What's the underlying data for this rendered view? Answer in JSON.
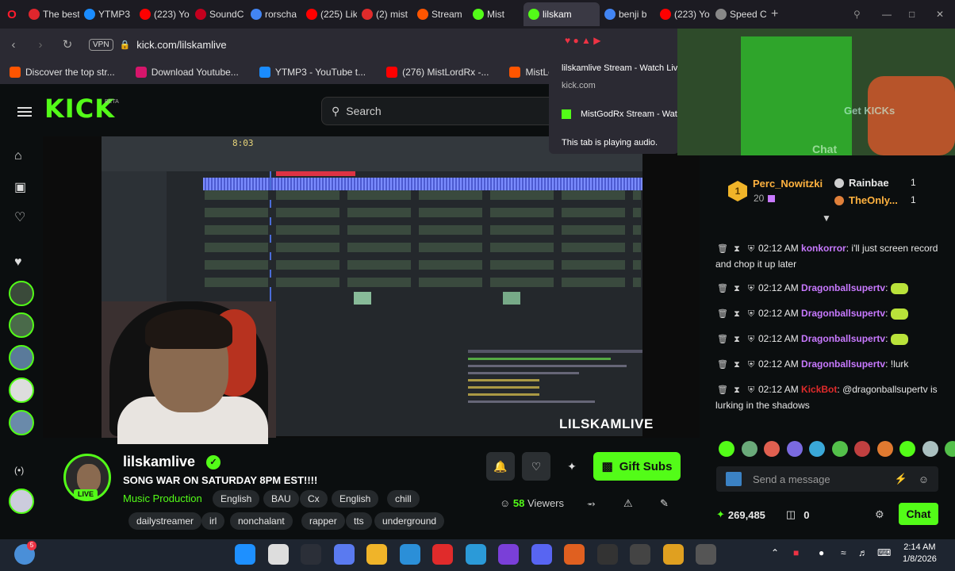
{
  "browser": {
    "tabs": [
      {
        "label": "The best",
        "color": "#e0262d"
      },
      {
        "label": "YTMP3",
        "color": "#1a8cff"
      },
      {
        "label": "(223) Yo",
        "color": "#ff0000"
      },
      {
        "label": "SoundC",
        "color": "#c3001e"
      },
      {
        "label": "rorscha",
        "color": "#4285f4"
      },
      {
        "label": "(225) Lik",
        "color": "#ff0000"
      },
      {
        "label": "(2) mist",
        "color": "#e02b2b"
      },
      {
        "label": "Stream",
        "color": "#ff5500"
      },
      {
        "label": "Mist",
        "color": "#53fc18"
      },
      {
        "label": "lilskam",
        "color": "#53fc18"
      },
      {
        "label": "benji b",
        "color": "#4285f4"
      },
      {
        "label": "(223) Yo",
        "color": "#ff0000"
      },
      {
        "label": "Speed C",
        "color": "#888888"
      }
    ],
    "url": "kick.com/lilskamlive",
    "vpn_label": "VPN",
    "bookmarks": [
      {
        "label": "Discover the top str...",
        "color": "#ff5500"
      },
      {
        "label": "Download Youtube...",
        "color": "#d6156b"
      },
      {
        "label": "YTMP3 - YouTube t...",
        "color": "#1a8cff"
      },
      {
        "label": "(276) MistLordRx -...",
        "color": "#ff0000"
      },
      {
        "label": "MistLordRx idek...",
        "color": "#ff5500"
      }
    ]
  },
  "tab_popup": {
    "title": "lilskamlive Stream - Watch Live on Kick",
    "domain": "kick.com",
    "other_tab": "MistGodRx Stream - Watch Live on Kick",
    "audio_note": "This tab is playing audio."
  },
  "kick": {
    "logo": "KICK",
    "beta": "BETA",
    "search_placeholder": "Search"
  },
  "video": {
    "watermark": "LILSKAMLIVE",
    "daw_time": "8:03"
  },
  "channel": {
    "name": "lilskamlive",
    "live_badge": "LIVE",
    "stream_title": "SONG WAR ON SATURDAY 8PM EST!!!!",
    "category": "Music Production",
    "tags_row1": [
      "English",
      "BAU",
      "Cx",
      "English",
      "chill"
    ],
    "tags_row2": [
      "dailystreamer",
      "irl",
      "nonchalant",
      "rapper",
      "tts",
      "underground"
    ],
    "gift_label": "Gift Subs",
    "viewers_count": "58",
    "viewers_label": "Viewers"
  },
  "leaderboard": {
    "first_name": "Perc_Nowitzki",
    "first_count": "20",
    "second_name": "Rainbae",
    "second_count": "1",
    "third_name": "TheOnly...",
    "third_count": "1"
  },
  "chat": {
    "messages": [
      {
        "time": "02:12 AM",
        "user": "konkorror",
        "color": "#c879ff",
        "text": "i'll just screen record and chop it up later"
      },
      {
        "time": "02:12 AM",
        "user": "Dragonballsupertv",
        "color": "#c879ff",
        "text": ""
      },
      {
        "time": "02:12 AM",
        "user": "Dragonballsupertv",
        "color": "#c879ff",
        "text": ""
      },
      {
        "time": "02:12 AM",
        "user": "Dragonballsupertv",
        "color": "#c879ff",
        "text": ""
      },
      {
        "time": "02:12 AM",
        "user": "Dragonballsupertv",
        "color": "#c879ff",
        "text": "!lurk"
      },
      {
        "time": "02:12 AM",
        "user": "KickBot",
        "color": "#e02b2b",
        "text": "@dragonballsupertv is lurking in the shadows"
      }
    ],
    "input_placeholder": "Send a message",
    "points": "269,485",
    "gift_count": "0",
    "chat_button": "Chat",
    "overlay_get_kicks": "Get KICKs",
    "overlay_chat": "Chat"
  },
  "taskbar": {
    "time": "2:14 AM",
    "date": "1/8/2026",
    "notification_badge": "5"
  },
  "colors": {
    "kick_green": "#53fc18",
    "bg": "#0b0e0f",
    "chat_user": "#c879ff",
    "kickbot": "#e02b2b"
  }
}
